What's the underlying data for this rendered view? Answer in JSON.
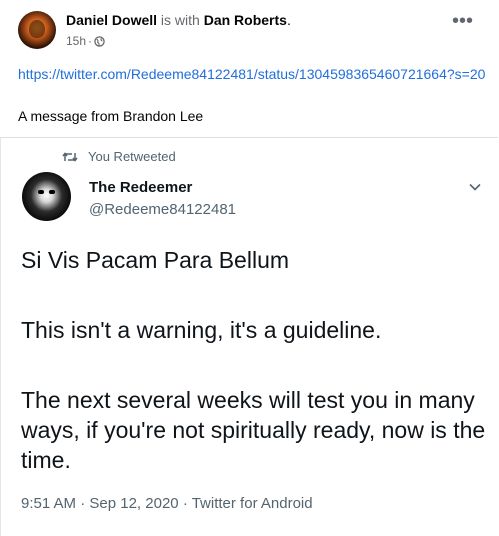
{
  "post": {
    "author": "Daniel Dowell",
    "with_text": "is with",
    "tagged": "Dan Roberts",
    "period": ".",
    "time": "15h",
    "separator": "·",
    "link": "https://twitter.com/Redeeme84122481/status/1304598365460721664?s=20",
    "message": "A message from Brandon Lee"
  },
  "tweet": {
    "retweet_label": "You Retweeted",
    "name": "The Redeemer",
    "handle": "@Redeeme84122481",
    "paragraphs": [
      "Si Vis Pacam Para Bellum",
      "This isn't a warning, it's a guideline.",
      "The next several weeks will test you in many ways, if you're not spiritually ready, now is the time."
    ],
    "time": "9:51 AM",
    "date": "Sep 12, 2020",
    "source": "Twitter for Android",
    "sep": "·"
  },
  "icons": {
    "privacy": "globe-icon",
    "more": "more-options-icon",
    "retweet": "retweet-icon",
    "caret": "chevron-down-icon"
  },
  "colors": {
    "link": "#216fdb",
    "secondary_text": "#65676b",
    "twitter_secondary": "#536471"
  }
}
